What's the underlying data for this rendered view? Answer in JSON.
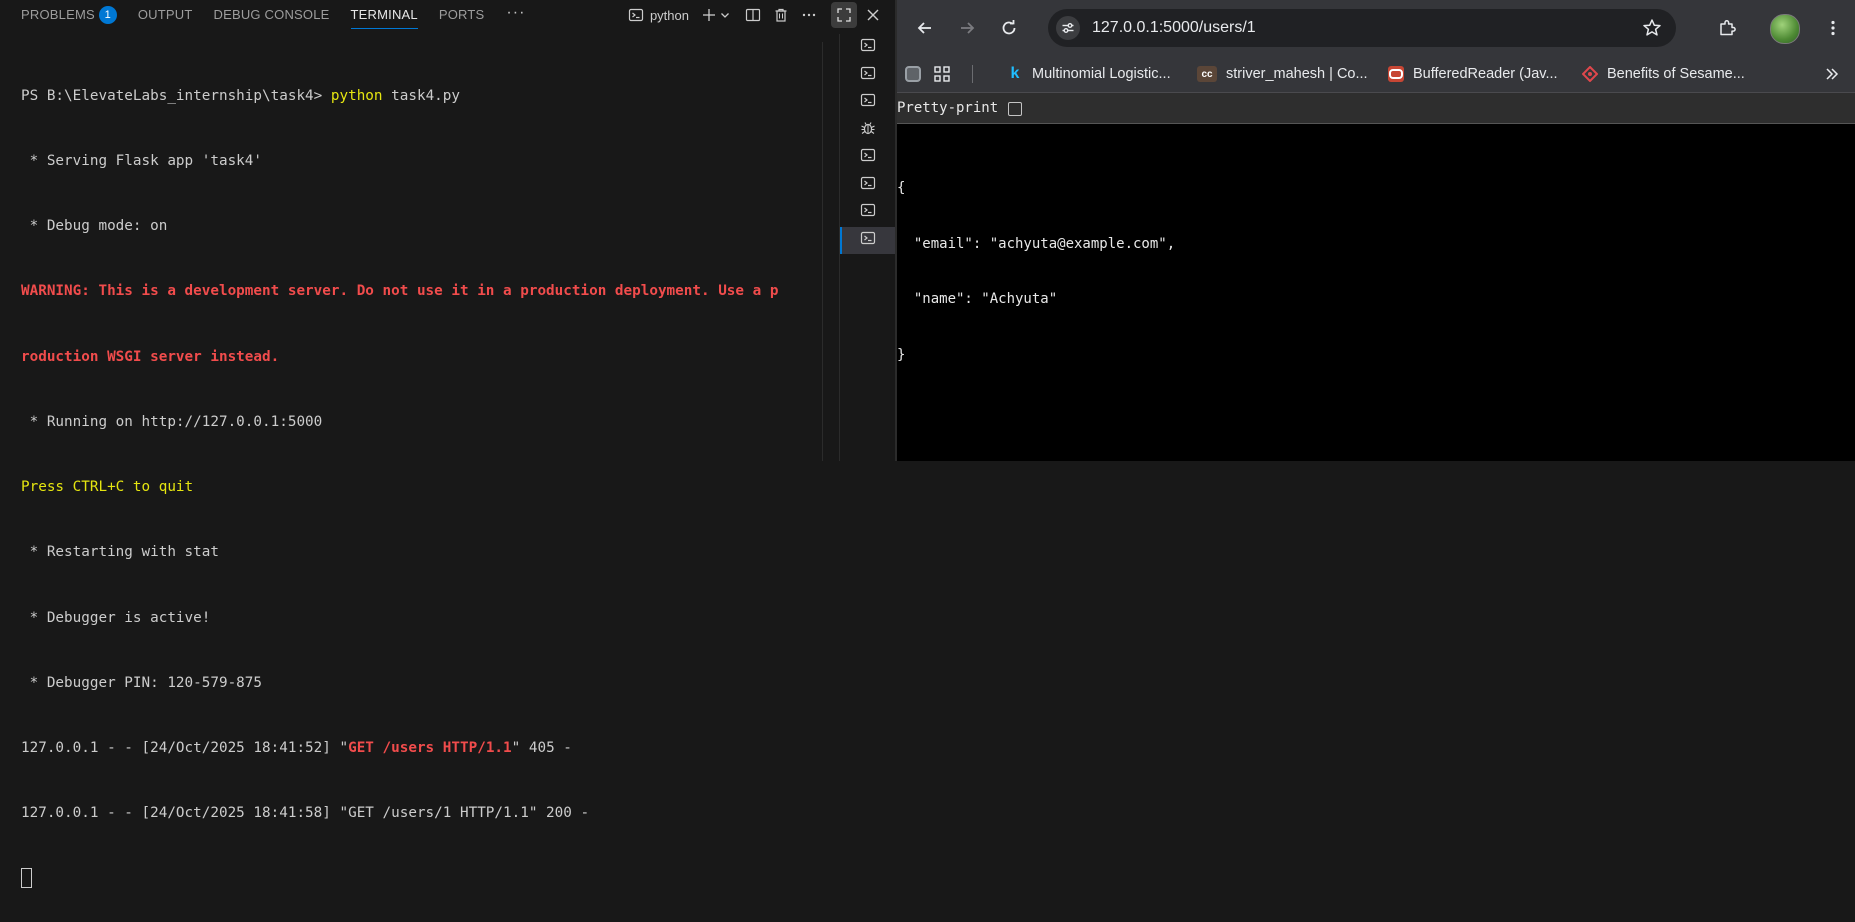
{
  "vscode": {
    "tabs": [
      {
        "label": "PROBLEMS",
        "badge": "1"
      },
      {
        "label": "OUTPUT"
      },
      {
        "label": "DEBUG CONSOLE"
      },
      {
        "label": "TERMINAL",
        "active": true
      },
      {
        "label": "PORTS"
      }
    ],
    "more_tabs": "···",
    "terminal_name": "python",
    "terminal": {
      "prompt": "PS B:\\ElevateLabs_internship\\task4> ",
      "command": "python",
      "command_args": " task4.py",
      "lines": [
        " * Serving Flask app 'task4'",
        " * Debug mode: on"
      ],
      "warning_line1": "WARNING: This is a development server. Do not use it in a production deployment. Use a p",
      "warning_line2": "roduction WSGI server instead.",
      "running": " * Running on http://127.0.0.1:5000",
      "quit": "Press CTRL+C to quit",
      "lines2": [
        " * Restarting with stat",
        " * Debugger is active!",
        " * Debugger PIN: 120-579-875"
      ],
      "log1_prefix": "127.0.0.1 - - [24/Oct/2025 18:41:52] \"",
      "log1_request": "GET /users HTTP/1.1",
      "log1_suffix": "\" 405 -",
      "log2": "127.0.0.1 - - [24/Oct/2025 18:41:58] \"GET /users/1 HTTP/1.1\" 200 -"
    },
    "terminal_list_icons": [
      "terminal-icon",
      "terminal-icon",
      "terminal-icon",
      "debug-icon",
      "terminal-icon",
      "terminal-icon",
      "terminal-icon",
      "terminal-icon"
    ],
    "colors": {
      "accent": "#0078d4",
      "warning": "#f14c4c",
      "highlight": "#e5e510"
    }
  },
  "browser": {
    "url": "127.0.0.1:5000/users/1",
    "bookmarks": [
      {
        "label": "Multinomial Logistic...",
        "icon": "k"
      },
      {
        "label": "striver_mahesh | Co...",
        "icon": "cc"
      },
      {
        "label": "BufferedReader (Jav...",
        "icon": "oracle"
      },
      {
        "label": "Benefits of Sesame...",
        "icon": "diamond"
      }
    ],
    "pretty_print_label": "Pretty-print",
    "json_lines": [
      "{",
      "  \"email\": \"achyuta@example.com\",",
      "  \"name\": \"Achyuta\"",
      "}"
    ]
  }
}
